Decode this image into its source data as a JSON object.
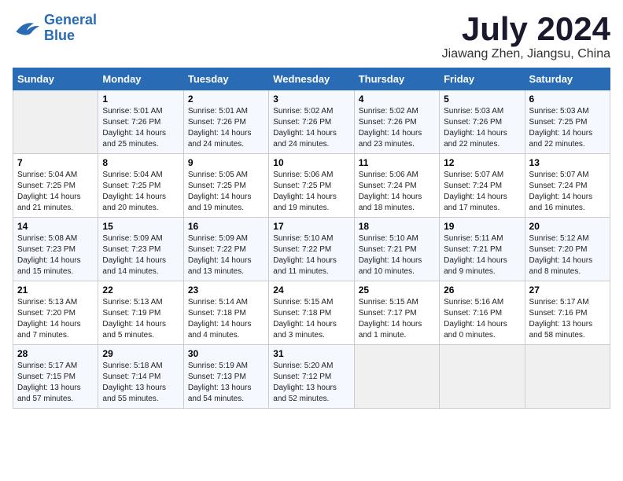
{
  "logo": {
    "line1": "General",
    "line2": "Blue"
  },
  "title": "July 2024",
  "location": "Jiawang Zhen, Jiangsu, China",
  "headers": [
    "Sunday",
    "Monday",
    "Tuesday",
    "Wednesday",
    "Thursday",
    "Friday",
    "Saturday"
  ],
  "weeks": [
    [
      {
        "day": "",
        "info": ""
      },
      {
        "day": "1",
        "info": "Sunrise: 5:01 AM\nSunset: 7:26 PM\nDaylight: 14 hours\nand 25 minutes."
      },
      {
        "day": "2",
        "info": "Sunrise: 5:01 AM\nSunset: 7:26 PM\nDaylight: 14 hours\nand 24 minutes."
      },
      {
        "day": "3",
        "info": "Sunrise: 5:02 AM\nSunset: 7:26 PM\nDaylight: 14 hours\nand 24 minutes."
      },
      {
        "day": "4",
        "info": "Sunrise: 5:02 AM\nSunset: 7:26 PM\nDaylight: 14 hours\nand 23 minutes."
      },
      {
        "day": "5",
        "info": "Sunrise: 5:03 AM\nSunset: 7:26 PM\nDaylight: 14 hours\nand 22 minutes."
      },
      {
        "day": "6",
        "info": "Sunrise: 5:03 AM\nSunset: 7:25 PM\nDaylight: 14 hours\nand 22 minutes."
      }
    ],
    [
      {
        "day": "7",
        "info": "Sunrise: 5:04 AM\nSunset: 7:25 PM\nDaylight: 14 hours\nand 21 minutes."
      },
      {
        "day": "8",
        "info": "Sunrise: 5:04 AM\nSunset: 7:25 PM\nDaylight: 14 hours\nand 20 minutes."
      },
      {
        "day": "9",
        "info": "Sunrise: 5:05 AM\nSunset: 7:25 PM\nDaylight: 14 hours\nand 19 minutes."
      },
      {
        "day": "10",
        "info": "Sunrise: 5:06 AM\nSunset: 7:25 PM\nDaylight: 14 hours\nand 19 minutes."
      },
      {
        "day": "11",
        "info": "Sunrise: 5:06 AM\nSunset: 7:24 PM\nDaylight: 14 hours\nand 18 minutes."
      },
      {
        "day": "12",
        "info": "Sunrise: 5:07 AM\nSunset: 7:24 PM\nDaylight: 14 hours\nand 17 minutes."
      },
      {
        "day": "13",
        "info": "Sunrise: 5:07 AM\nSunset: 7:24 PM\nDaylight: 14 hours\nand 16 minutes."
      }
    ],
    [
      {
        "day": "14",
        "info": "Sunrise: 5:08 AM\nSunset: 7:23 PM\nDaylight: 14 hours\nand 15 minutes."
      },
      {
        "day": "15",
        "info": "Sunrise: 5:09 AM\nSunset: 7:23 PM\nDaylight: 14 hours\nand 14 minutes."
      },
      {
        "day": "16",
        "info": "Sunrise: 5:09 AM\nSunset: 7:22 PM\nDaylight: 14 hours\nand 13 minutes."
      },
      {
        "day": "17",
        "info": "Sunrise: 5:10 AM\nSunset: 7:22 PM\nDaylight: 14 hours\nand 11 minutes."
      },
      {
        "day": "18",
        "info": "Sunrise: 5:10 AM\nSunset: 7:21 PM\nDaylight: 14 hours\nand 10 minutes."
      },
      {
        "day": "19",
        "info": "Sunrise: 5:11 AM\nSunset: 7:21 PM\nDaylight: 14 hours\nand 9 minutes."
      },
      {
        "day": "20",
        "info": "Sunrise: 5:12 AM\nSunset: 7:20 PM\nDaylight: 14 hours\nand 8 minutes."
      }
    ],
    [
      {
        "day": "21",
        "info": "Sunrise: 5:13 AM\nSunset: 7:20 PM\nDaylight: 14 hours\nand 7 minutes."
      },
      {
        "day": "22",
        "info": "Sunrise: 5:13 AM\nSunset: 7:19 PM\nDaylight: 14 hours\nand 5 minutes."
      },
      {
        "day": "23",
        "info": "Sunrise: 5:14 AM\nSunset: 7:18 PM\nDaylight: 14 hours\nand 4 minutes."
      },
      {
        "day": "24",
        "info": "Sunrise: 5:15 AM\nSunset: 7:18 PM\nDaylight: 14 hours\nand 3 minutes."
      },
      {
        "day": "25",
        "info": "Sunrise: 5:15 AM\nSunset: 7:17 PM\nDaylight: 14 hours\nand 1 minute."
      },
      {
        "day": "26",
        "info": "Sunrise: 5:16 AM\nSunset: 7:16 PM\nDaylight: 14 hours\nand 0 minutes."
      },
      {
        "day": "27",
        "info": "Sunrise: 5:17 AM\nSunset: 7:16 PM\nDaylight: 13 hours\nand 58 minutes."
      }
    ],
    [
      {
        "day": "28",
        "info": "Sunrise: 5:17 AM\nSunset: 7:15 PM\nDaylight: 13 hours\nand 57 minutes."
      },
      {
        "day": "29",
        "info": "Sunrise: 5:18 AM\nSunset: 7:14 PM\nDaylight: 13 hours\nand 55 minutes."
      },
      {
        "day": "30",
        "info": "Sunrise: 5:19 AM\nSunset: 7:13 PM\nDaylight: 13 hours\nand 54 minutes."
      },
      {
        "day": "31",
        "info": "Sunrise: 5:20 AM\nSunset: 7:12 PM\nDaylight: 13 hours\nand 52 minutes."
      },
      {
        "day": "",
        "info": ""
      },
      {
        "day": "",
        "info": ""
      },
      {
        "day": "",
        "info": ""
      }
    ]
  ]
}
